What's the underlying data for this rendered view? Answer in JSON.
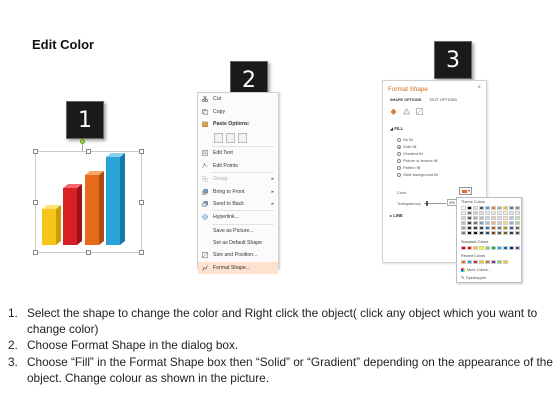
{
  "title": "Edit Color",
  "steps": [
    "1",
    "2",
    "3"
  ],
  "chart": {
    "colors": {
      "yellow": "#f5c518",
      "red": "#d81f26",
      "orange": "#e86a1d",
      "blue": "#2aa3d8"
    }
  },
  "context_menu": {
    "items": [
      {
        "label": "Cut",
        "icon": "scissors-icon",
        "disabled": false
      },
      {
        "label": "Copy",
        "icon": "copy-icon",
        "disabled": false
      },
      {
        "label": "Paste Options:",
        "icon": "clipboard-icon",
        "disabled": false
      },
      {
        "label": "Edit Text",
        "icon": "edit-text-icon",
        "disabled": false
      },
      {
        "label": "Edit Points",
        "icon": "edit-points-icon",
        "disabled": false
      },
      {
        "label": "Group",
        "icon": "group-icon",
        "disabled": true
      },
      {
        "label": "Bring to Front",
        "icon": "bring-front-icon",
        "disabled": false
      },
      {
        "label": "Send to Back",
        "icon": "send-back-icon",
        "disabled": false
      },
      {
        "label": "Hyperlink...",
        "icon": "hyperlink-icon",
        "disabled": false
      },
      {
        "label": "Save as Picture...",
        "icon": "none",
        "disabled": false
      },
      {
        "label": "Set as Default Shape",
        "icon": "none",
        "disabled": false
      },
      {
        "label": "Size and Position...",
        "icon": "size-position-icon",
        "disabled": false
      },
      {
        "label": "Format Shape...",
        "icon": "format-shape-icon",
        "disabled": false
      }
    ]
  },
  "format_shape": {
    "header": "Format Shape",
    "close": "×",
    "tabs": [
      "SHAPE OPTIONS",
      "TEXT OPTIONS"
    ],
    "fill_section": "FILL",
    "fill_options": [
      "No fill",
      "Solid fill",
      "Gradient fill",
      "Picture or texture fill",
      "Pattern fill",
      "Slide background fill"
    ],
    "selected_fill": "Solid fill",
    "color_label": "Color",
    "transparency_label": "Transparency",
    "transparency_value": "0%",
    "line_section": "LINE",
    "palette": {
      "theme_label": "Theme Colors",
      "standard_label": "Standard Colors",
      "recent_label": "Recent Colors",
      "more_colors": "More Colors...",
      "eyedropper": "Eyedropper"
    }
  },
  "instructions": [
    {
      "num": "1.",
      "text": "Select the shape to change the color and Right click the object( click any object which you want to change color)"
    },
    {
      "num": "2.",
      "text": "Choose Format Shape in the dialog box."
    },
    {
      "num": "3.",
      "text": "Choose “Fill” in the Format Shape box then “Solid” or “Gradient” depending on the appearance of the object. Change colour as shown in the picture."
    }
  ]
}
